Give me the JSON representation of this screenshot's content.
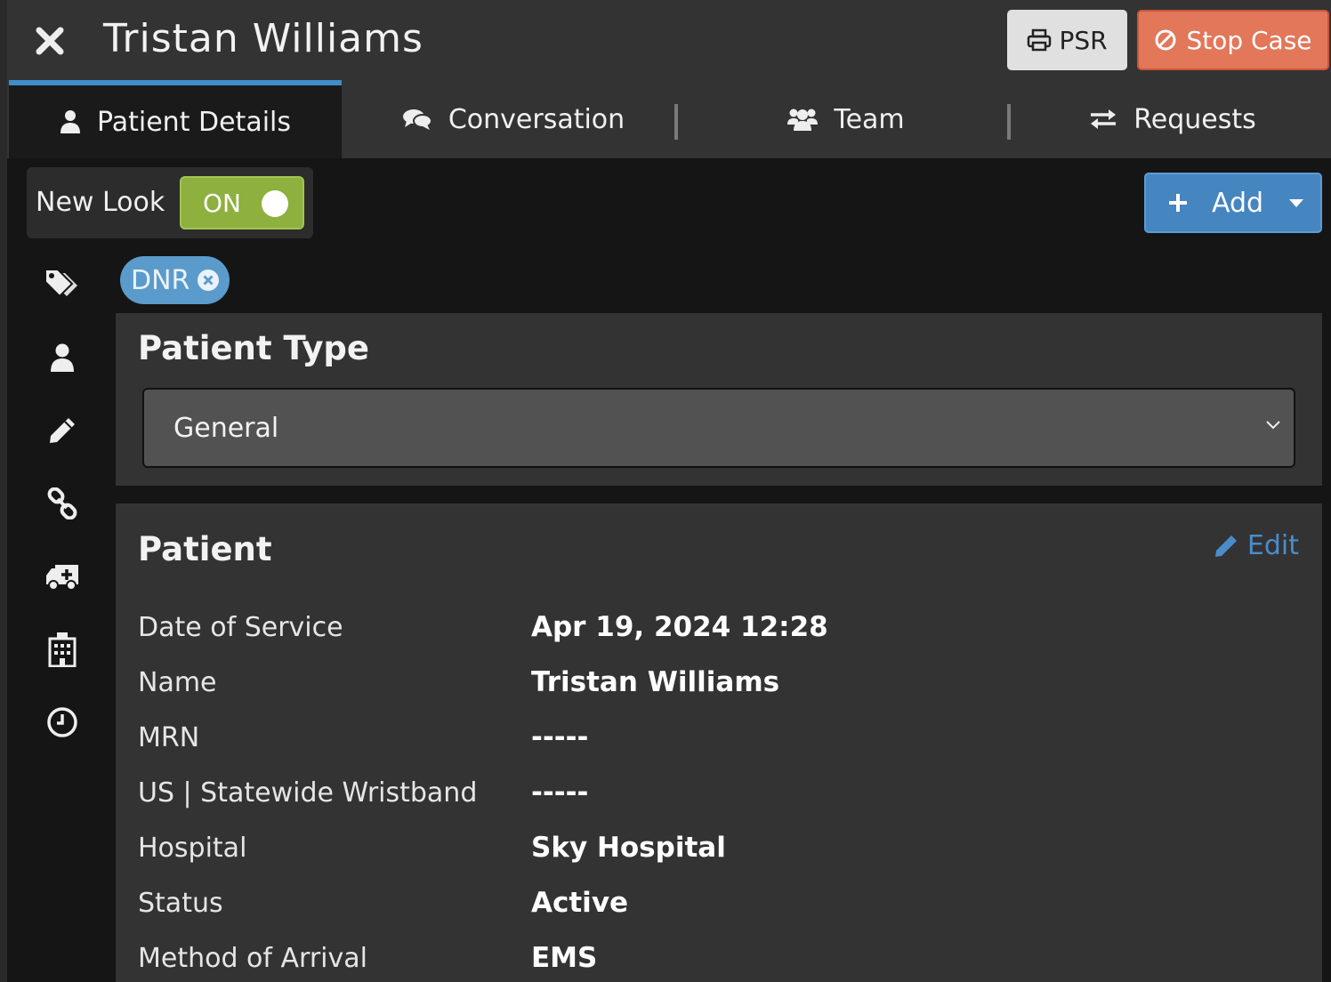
{
  "header": {
    "title": "Tristan Williams",
    "psr_label": "PSR",
    "stop_label": "Stop Case"
  },
  "tabs": [
    {
      "label": "Patient Details",
      "icon": "user-icon",
      "active": true
    },
    {
      "label": "Conversation",
      "icon": "comments-icon",
      "active": false
    },
    {
      "label": "Team",
      "icon": "users-icon",
      "active": false
    },
    {
      "label": "Requests",
      "icon": "exchange-icon",
      "active": false
    }
  ],
  "toolbar": {
    "new_look_label": "New Look",
    "toggle_state": "ON",
    "add_label": "Add"
  },
  "side_nav": [
    "tags-icon",
    "user-icon",
    "pencil-icon",
    "link-icon",
    "ambulance-icon",
    "hospital-icon",
    "clock-icon"
  ],
  "tags": [
    {
      "label": "DNR"
    }
  ],
  "patient_type": {
    "title": "Patient Type",
    "selected": "General"
  },
  "patient": {
    "title": "Patient",
    "edit_label": "Edit",
    "fields": [
      {
        "label": "Date of Service",
        "value": "Apr 19, 2024 12:28"
      },
      {
        "label": "Name",
        "value": "Tristan Williams"
      },
      {
        "label": "MRN",
        "value": "-----"
      },
      {
        "label": "US | Statewide Wristband",
        "value": "-----"
      },
      {
        "label": "Hospital",
        "value": "Sky Hospital"
      },
      {
        "label": "Status",
        "value": "Active"
      },
      {
        "label": "Method of Arrival",
        "value": "EMS"
      }
    ]
  },
  "colors": {
    "accent": "#3f8dc9",
    "stop": "#e2775a",
    "toggle_on": "#8db03e",
    "add": "#4585c0",
    "tag": "#5a9bcb"
  }
}
